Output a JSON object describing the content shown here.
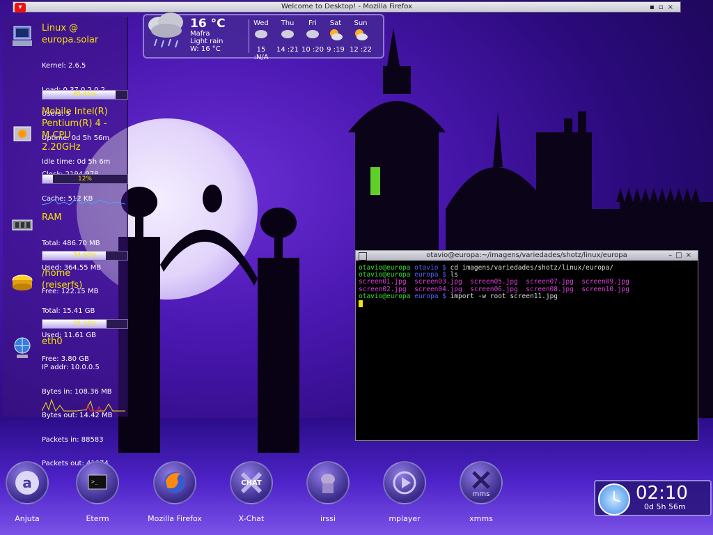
{
  "window": {
    "title": "Welcome to Desktop! - Mozilla Firefox"
  },
  "system": {
    "title_line1": "Linux @",
    "title_line2": "europa.solar",
    "kernel": "Kernel: 2.6.5",
    "load": "Load: 0.37 0.2 0.2",
    "users": "Users: 5",
    "uptime": "Uptime: 0d 5h 56m",
    "idle": "Idle time: 0d 5h 6m",
    "bar_label": "85.85%",
    "bar_value": 85.85
  },
  "cpu": {
    "title_line1": "Mobile Intel(R)",
    "title_line2": "Pentium(R) 4 -",
    "title_line3": "M CPU",
    "title_line4": "2.20GHz",
    "clock": "Clock: 2194.978",
    "cache": "Cache: 512 KB",
    "bar_label": "12%",
    "bar_value": 12
  },
  "ram": {
    "title": "RAM",
    "total": "Total: 486.70 MB",
    "used": "Used: 364.55 MB",
    "free": "Free: 122.15 MB",
    "bar_label": "74.90%",
    "bar_value": 74.9
  },
  "disk": {
    "title_line1": "/home",
    "title_line2": "(reiserfs)",
    "total": "Total: 15.41 GB",
    "used": "Used: 11.61 GB",
    "free": "Free: 3.80 GB",
    "bar_label": "75.32%",
    "bar_value": 75.32
  },
  "network": {
    "title": "eth0",
    "ip": "IP addr: 10.0.0.5",
    "bytes_in": "Bytes in: 108.36 MB",
    "bytes_out": "Bytes out: 14.42 MB",
    "packets_in": "Packets in: 88583",
    "packets_out": "Packets out: 41074"
  },
  "weather": {
    "temp": "16 °C",
    "location": "Mafra",
    "condition": "Light rain",
    "wind": "W: 16 °C",
    "forecast": [
      {
        "day": "Wed",
        "value": "15 :N/A"
      },
      {
        "day": "Thu",
        "value": "14 :21"
      },
      {
        "day": "Fri",
        "value": "10 :20"
      },
      {
        "day": "Sat",
        "value": "9 :19"
      },
      {
        "day": "Sun",
        "value": "12 :22"
      }
    ]
  },
  "terminal": {
    "title": "otavio@europa:~/imagens/variedades/shotz/linux/europa",
    "lines": [
      {
        "user": "otavio@europa",
        "host": "otavio $",
        "cmd": " cd imagens/variedades/shotz/linux/europa/"
      },
      {
        "user": "otavio@europa",
        "host": "europa $",
        "cmd": " ls"
      },
      {
        "files": "screen01.jpg  screen03.jpg  screen05.jpg  screen07.jpg  screen09.jpg"
      },
      {
        "files": "screen02.jpg  screen04.jpg  screen06.jpg  screen08.jpg  screen10.jpg"
      },
      {
        "user": "otavio@europa",
        "host": "europa $",
        "cmd": " import -w root screen11.jpg"
      }
    ]
  },
  "dock": [
    {
      "label": "Anjuta",
      "icon": "anjuta-icon"
    },
    {
      "label": "Eterm",
      "icon": "eterm-icon"
    },
    {
      "label": "Mozilla Firefox",
      "icon": "firefox-icon"
    },
    {
      "label": "X-Chat",
      "icon": "xchat-icon"
    },
    {
      "label": "irssi",
      "icon": "irssi-icon"
    },
    {
      "label": "mplayer",
      "icon": "mplayer-icon"
    },
    {
      "label": "xmms",
      "icon": "xmms-icon"
    }
  ],
  "dock_badges": {
    "xchat": "CHAT",
    "xmms": "mms"
  },
  "clock": {
    "time": "02:10",
    "uptime": "0d 5h 56m"
  }
}
